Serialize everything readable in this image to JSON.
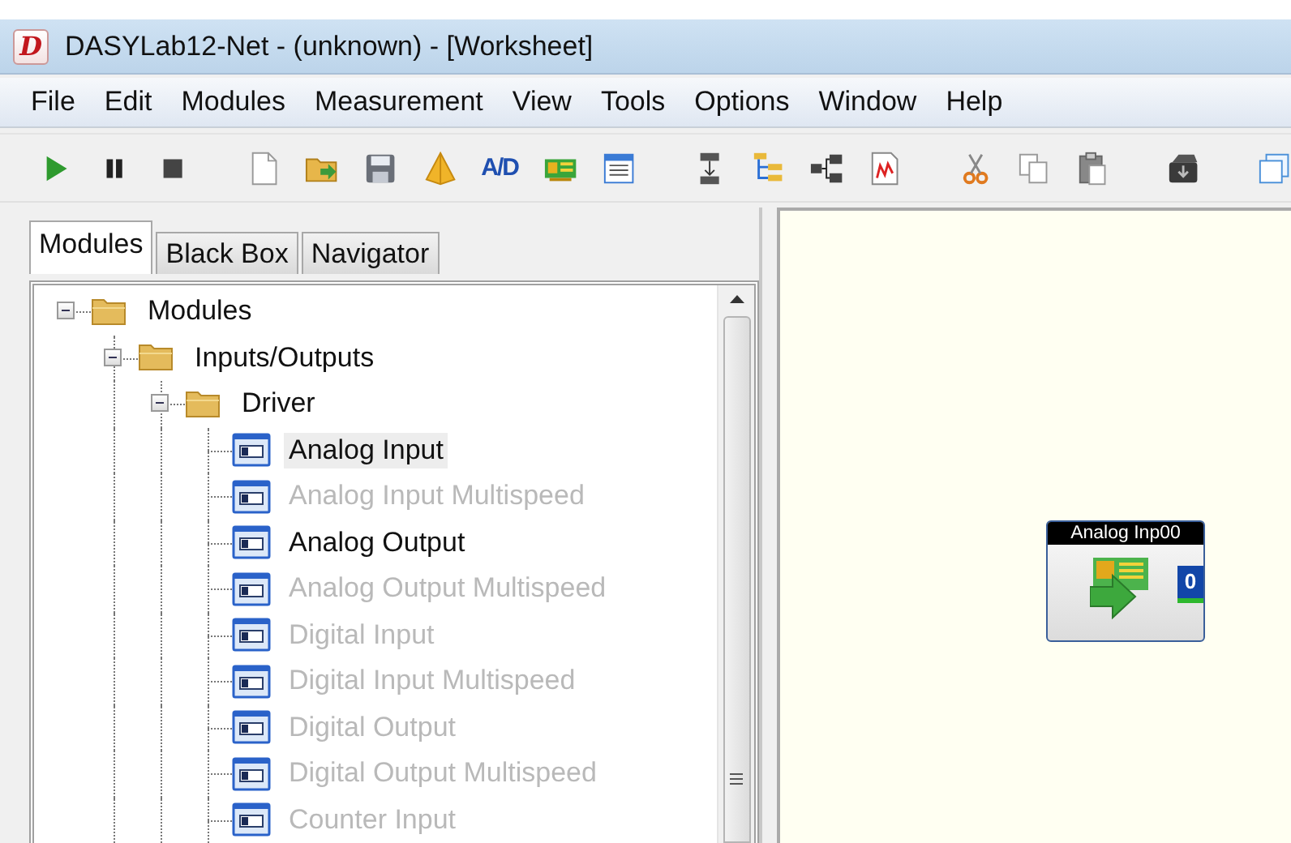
{
  "window": {
    "app_icon": "D",
    "title": "DASYLab12-Net - (unknown) - [Worksheet]"
  },
  "menu": [
    "File",
    "Edit",
    "Modules",
    "Measurement",
    "View",
    "Tools",
    "Options",
    "Window",
    "Help"
  ],
  "toolbar": {
    "ad_button": "A/D"
  },
  "panel": {
    "tabs": [
      {
        "label": "Modules",
        "selected": true
      },
      {
        "label": "Black Box",
        "selected": false
      },
      {
        "label": "Navigator",
        "selected": false
      }
    ],
    "tree": [
      {
        "label": "Modules",
        "kind": "folder",
        "expanded": true,
        "selected": false,
        "disabled": false,
        "children": [
          {
            "label": "Inputs/Outputs",
            "kind": "folder",
            "expanded": true,
            "selected": false,
            "disabled": false,
            "children": [
              {
                "label": "Driver",
                "kind": "folder",
                "expanded": true,
                "selected": false,
                "disabled": false,
                "children": [
                  {
                    "label": "Analog Input",
                    "kind": "module",
                    "selected": true,
                    "disabled": false
                  },
                  {
                    "label": "Analog Input Multispeed",
                    "kind": "module",
                    "selected": false,
                    "disabled": true
                  },
                  {
                    "label": "Analog Output",
                    "kind": "module",
                    "selected": false,
                    "disabled": false
                  },
                  {
                    "label": "Analog Output Multispeed",
                    "kind": "module",
                    "selected": false,
                    "disabled": true
                  },
                  {
                    "label": "Digital Input",
                    "kind": "module",
                    "selected": false,
                    "disabled": true
                  },
                  {
                    "label": "Digital Input Multispeed",
                    "kind": "module",
                    "selected": false,
                    "disabled": true
                  },
                  {
                    "label": "Digital Output",
                    "kind": "module",
                    "selected": false,
                    "disabled": true
                  },
                  {
                    "label": "Digital Output Multispeed",
                    "kind": "module",
                    "selected": false,
                    "disabled": true
                  },
                  {
                    "label": "Counter Input",
                    "kind": "module",
                    "selected": false,
                    "disabled": true
                  }
                ]
              }
            ]
          }
        ]
      }
    ]
  },
  "worksheet": {
    "modules": [
      {
        "title": "Analog Inp00",
        "value": "0"
      }
    ]
  }
}
